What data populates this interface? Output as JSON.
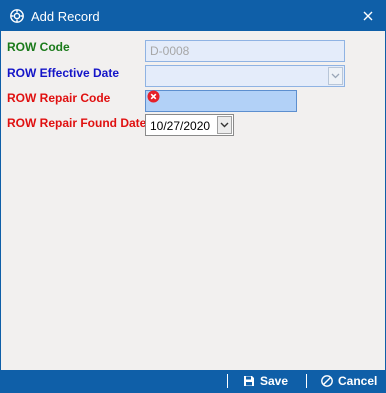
{
  "window": {
    "title": "Add Record",
    "title_icon": "gear-circle-icon",
    "close_icon": "close-icon"
  },
  "form": {
    "row_code": {
      "label": "ROW Code",
      "value": "D-0008",
      "label_color": "#1a7a1a"
    },
    "row_effective_date": {
      "label": "ROW Effective Date",
      "value": "",
      "label_color": "#1414c8"
    },
    "row_repair_code": {
      "label": "ROW Repair Code",
      "value": "",
      "label_color": "#e01010",
      "error_icon": "error-icon"
    },
    "row_repair_found_date": {
      "label": "ROW Repair Found Date",
      "value": "10/27/2020",
      "label_color": "#e01010"
    }
  },
  "footer": {
    "save_label": "Save",
    "save_icon": "save-icon",
    "cancel_label": "Cancel",
    "cancel_icon": "cancel-icon"
  },
  "colors": {
    "accent": "#0f5fa8",
    "dialog_bg": "#f2f0ef"
  }
}
